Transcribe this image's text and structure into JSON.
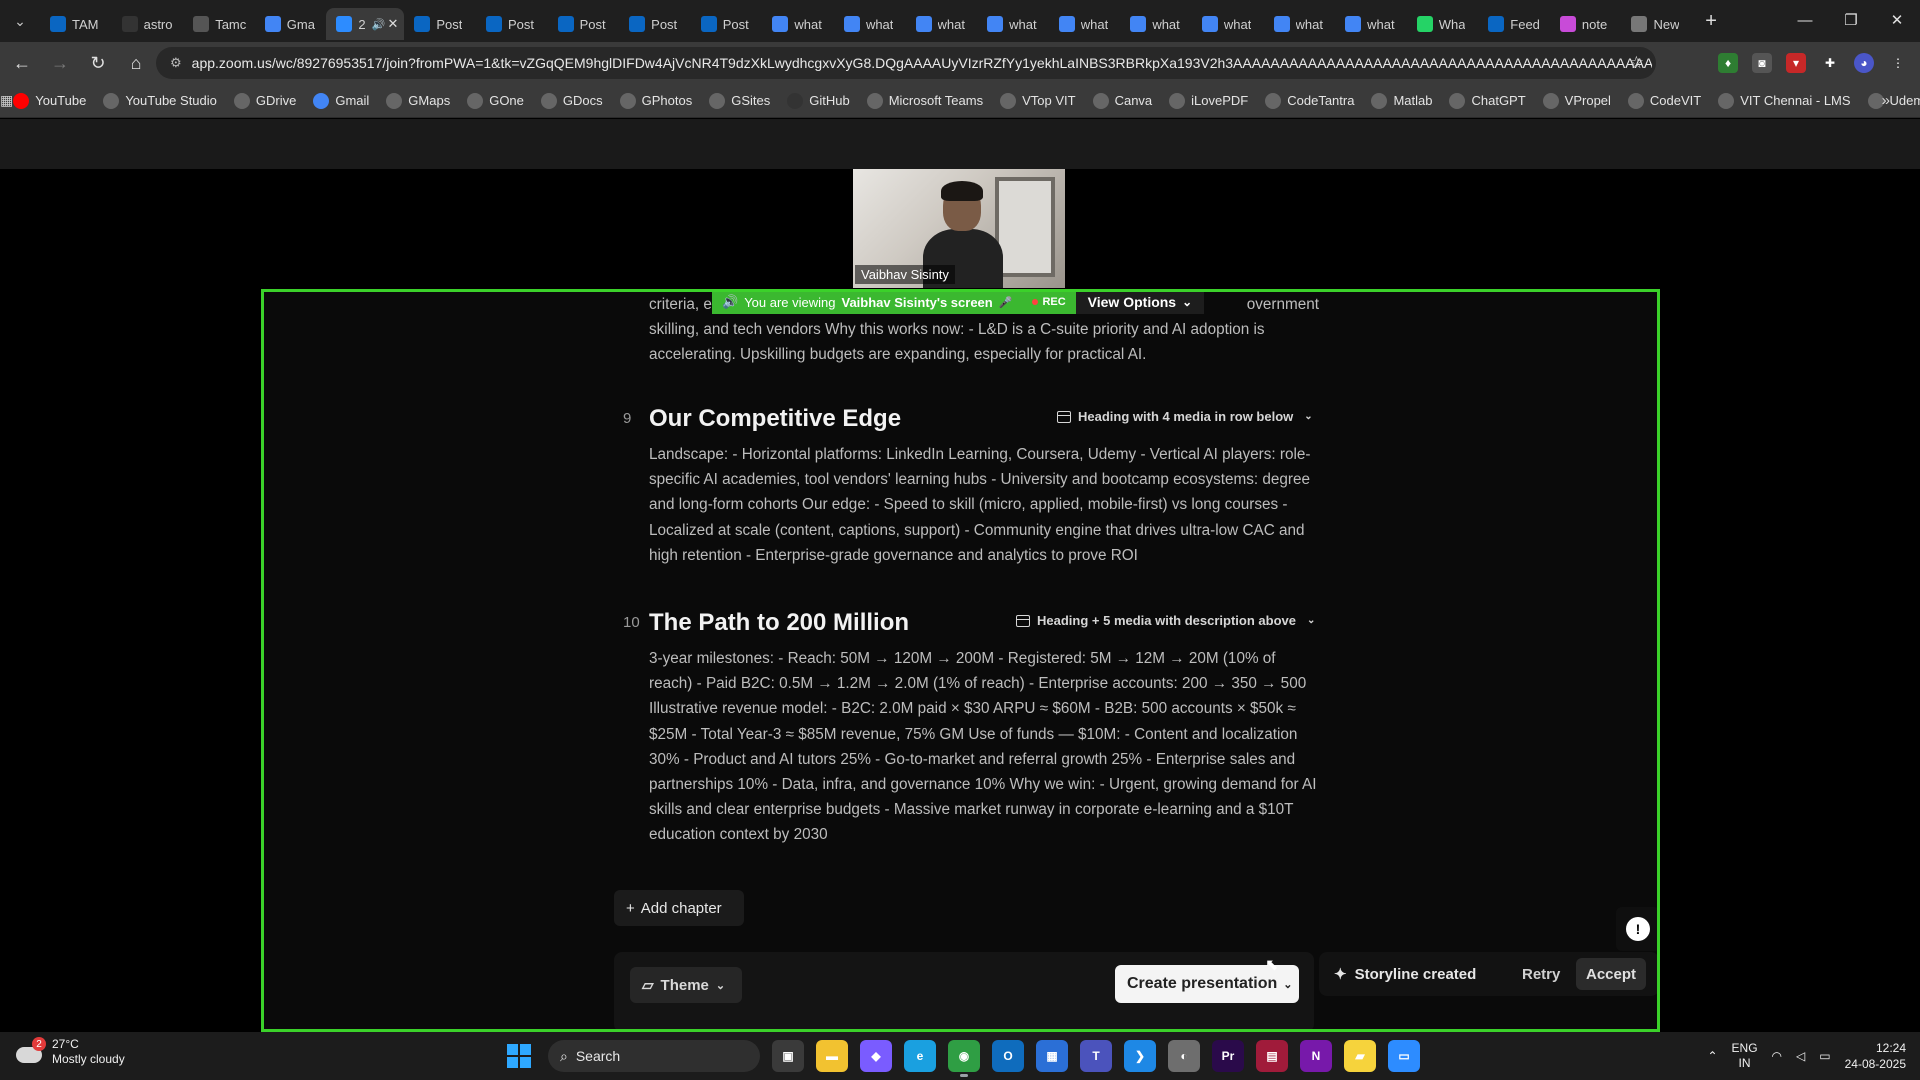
{
  "browser": {
    "tabs": [
      {
        "title": "TAM",
        "icon": "linkedin-icon",
        "color": "#0a66c2"
      },
      {
        "title": "astro",
        "icon": "github-icon",
        "color": "#333333"
      },
      {
        "title": "Tamc",
        "icon": "globe-icon",
        "color": "#555555"
      },
      {
        "title": "Gma",
        "icon": "google-icon",
        "color": "#4285f4"
      },
      {
        "title": "2",
        "icon": "zoom-icon",
        "color": "#2d8cff",
        "active": true
      },
      {
        "title": "Post",
        "icon": "linkedin-icon",
        "color": "#0a66c2"
      },
      {
        "title": "Post",
        "icon": "linkedin-icon",
        "color": "#0a66c2"
      },
      {
        "title": "Post",
        "icon": "linkedin-icon",
        "color": "#0a66c2"
      },
      {
        "title": "Post",
        "icon": "linkedin-icon",
        "color": "#0a66c2"
      },
      {
        "title": "Post",
        "icon": "linkedin-icon",
        "color": "#0a66c2"
      },
      {
        "title": "what",
        "icon": "google-icon",
        "color": "#4285f4"
      },
      {
        "title": "what",
        "icon": "google-icon",
        "color": "#4285f4"
      },
      {
        "title": "what",
        "icon": "google-icon",
        "color": "#4285f4"
      },
      {
        "title": "what",
        "icon": "google-icon",
        "color": "#4285f4"
      },
      {
        "title": "what",
        "icon": "google-icon",
        "color": "#4285f4"
      },
      {
        "title": "what",
        "icon": "google-icon",
        "color": "#4285f4"
      },
      {
        "title": "what",
        "icon": "google-icon",
        "color": "#4285f4"
      },
      {
        "title": "what",
        "icon": "google-icon",
        "color": "#4285f4"
      },
      {
        "title": "what",
        "icon": "google-icon",
        "color": "#4285f4"
      },
      {
        "title": "Wha",
        "icon": "whatsapp-icon",
        "color": "#25d366"
      },
      {
        "title": "Feed",
        "icon": "linkedin-icon",
        "color": "#0a66c2"
      },
      {
        "title": "note",
        "icon": "notebook-icon",
        "color": "#c84bd8"
      },
      {
        "title": "New",
        "icon": "chrome-icon",
        "color": "#777777"
      }
    ],
    "url": "app.zoom.us/wc/89276953517/join?fromPWA=1&tk=vZGqQEM9hglDIFDw4AjVcNR4T9dzXkLwydhcgxvXyG8.DQgAAAAUyVIzrRZfYy1yekhLaINBS3RBRkpXa193V2h3AAAAAAAAAAAAAAAAAAAAAAAAAAAAAAAAAAAAAAAAAAAAAA&_x_zm_r...",
    "bookmarks": [
      {
        "label": "YouTube",
        "icon": "youtube-icon",
        "color": "#ff0000"
      },
      {
        "label": "YouTube Studio",
        "icon": "globe-icon",
        "color": "#666666"
      },
      {
        "label": "GDrive",
        "icon": "globe-icon",
        "color": "#666666"
      },
      {
        "label": "Gmail",
        "icon": "google-icon",
        "color": "#4285f4"
      },
      {
        "label": "GMaps",
        "icon": "globe-icon",
        "color": "#666666"
      },
      {
        "label": "GOne",
        "icon": "globe-icon",
        "color": "#666666"
      },
      {
        "label": "GDocs",
        "icon": "globe-icon",
        "color": "#666666"
      },
      {
        "label": "GPhotos",
        "icon": "globe-icon",
        "color": "#666666"
      },
      {
        "label": "GSites",
        "icon": "globe-icon",
        "color": "#666666"
      },
      {
        "label": "GitHub",
        "icon": "github-icon",
        "color": "#333333"
      },
      {
        "label": "Microsoft Teams",
        "icon": "globe-icon",
        "color": "#666666"
      },
      {
        "label": "VTop VIT",
        "icon": "globe-icon",
        "color": "#666666"
      },
      {
        "label": "Canva",
        "icon": "globe-icon",
        "color": "#666666"
      },
      {
        "label": "iLovePDF",
        "icon": "globe-icon",
        "color": "#666666"
      },
      {
        "label": "CodeTantra",
        "icon": "globe-icon",
        "color": "#666666"
      },
      {
        "label": "Matlab",
        "icon": "globe-icon",
        "color": "#666666"
      },
      {
        "label": "ChatGPT",
        "icon": "globe-icon",
        "color": "#666666"
      },
      {
        "label": "VPropel",
        "icon": "globe-icon",
        "color": "#666666"
      },
      {
        "label": "CodeVIT",
        "icon": "globe-icon",
        "color": "#666666"
      },
      {
        "label": "VIT Chennai - LMS",
        "icon": "globe-icon",
        "color": "#666666"
      },
      {
        "label": "Udemy",
        "icon": "globe-icon",
        "color": "#666666"
      }
    ]
  },
  "zoom": {
    "participant_name": "Vaibhav Sisinty",
    "banner_prefix": "You are viewing",
    "banner_screen": "Vaibhav Sisinty's screen",
    "rec_label": "REC",
    "view_options": "View Options",
    "accent": "#3bd12a"
  },
  "doc": {
    "top_text_line1_a": "criteria, e",
    "top_text_line1_b": "overnment",
    "top_text_rest": "skilling, and tech vendors Why this works now: - L&D is a C-suite priority and AI adoption is accelerating. Upskilling budgets are expanding, especially for practical AI.",
    "chapters": [
      {
        "number": "9",
        "title": "Our Competitive Edge",
        "layout": "Heading with 4 media in row below",
        "body": "Landscape: - Horizontal platforms: LinkedIn Learning, Coursera, Udemy - Vertical AI players: role-specific AI academies, tool vendors' learning hubs - University and bootcamp ecosystems: degree and long-form cohorts Our edge: - Speed to skill (micro, applied, mobile-first) vs long courses - Localized at scale (content, captions, support) - Community engine that drives ultra-low CAC and high retention - Enterprise-grade governance and analytics to prove ROI"
      },
      {
        "number": "10",
        "title": "The Path to 200 Million",
        "layout": "Heading + 5 media with description above",
        "body": "3-year milestones: - Reach: 50M → 120M → 200M - Registered: 5M → 12M → 20M (10% of reach) - Paid B2C: 0.5M → 1.2M → 2.0M (1% of reach) - Enterprise accounts: 200 → 350 → 500 Illustrative revenue model: - B2C: 2.0M paid × $30 ARPU ≈ $60M - B2B: 500 accounts × $50k ≈ $25M - Total Year-3 ≈ $85M revenue, 75% GM Use of funds — $10M: - Content and localization 30% - Product and AI tutors 25% - Go-to-market and referral growth 25% - Enterprise sales and partnerships 10% - Data, infra, and governance 10% Why we win: - Urgent, growing demand for AI skills and clear enterprise budgets - Massive market runway in corporate e-learning and a $10T education context by 2030"
      }
    ],
    "add_chapter": "Add chapter",
    "theme": "Theme",
    "create_presentation": "Create presentation",
    "storyline_created": "Storyline created",
    "retry": "Retry",
    "accept": "Accept"
  },
  "taskbar": {
    "temperature": "27°C",
    "weather": "Mostly cloudy",
    "weather_badge": "2",
    "search_label": "Search",
    "apps": [
      {
        "name": "task-view-icon",
        "color": "#3a3a3a",
        "glyph": "▣"
      },
      {
        "name": "file-explorer-icon",
        "color": "#f2c230",
        "glyph": "▬"
      },
      {
        "name": "copilot-icon",
        "color": "#7a5cff",
        "glyph": "◆"
      },
      {
        "name": "edge-icon",
        "color": "#1aa0e0",
        "glyph": "e"
      },
      {
        "name": "chrome-icon",
        "color": "#2f9e44",
        "glyph": "◉",
        "active": true
      },
      {
        "name": "outlook-icon",
        "color": "#0f6cbd",
        "glyph": "O"
      },
      {
        "name": "store-icon",
        "color": "#2b6fd6",
        "glyph": "▦"
      },
      {
        "name": "teams-icon",
        "color": "#4b53bc",
        "glyph": "T"
      },
      {
        "name": "vscode-icon",
        "color": "#1e88e5",
        "glyph": "❯"
      },
      {
        "name": "github-desktop-icon",
        "color": "#6e6e6e",
        "glyph": "◐"
      },
      {
        "name": "premiere-icon",
        "color": "#2a0a4a",
        "glyph": "Pr"
      },
      {
        "name": "calculator-icon",
        "color": "#a01b3a",
        "glyph": "▤"
      },
      {
        "name": "onenote-icon",
        "color": "#7719aa",
        "glyph": "N"
      },
      {
        "name": "sticky-notes-icon",
        "color": "#f6d33c",
        "glyph": "▰"
      },
      {
        "name": "zoom-app-icon",
        "color": "#2d8cff",
        "glyph": "▭"
      }
    ],
    "lang_top": "ENG",
    "lang_bottom": "IN",
    "time": "12:24",
    "date": "24-08-2025"
  }
}
